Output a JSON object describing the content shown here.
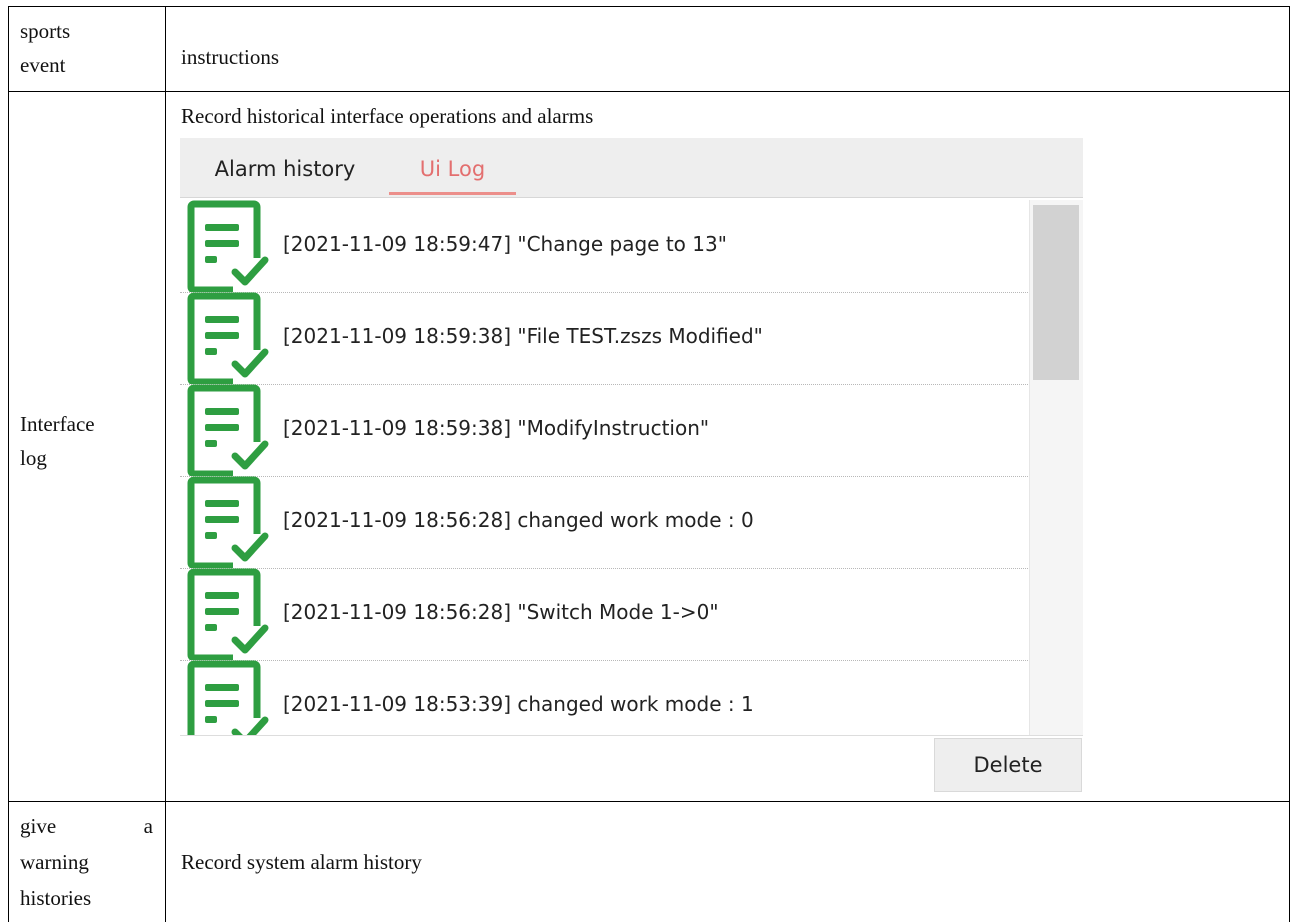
{
  "table": {
    "header": {
      "col1": "sports\nevent",
      "col2": "instructions"
    },
    "row_interface_log": {
      "label": "Interface\nlog",
      "description": "Record historical interface operations and alarms"
    },
    "row_alarm_history": {
      "label": "give a\nwarning\nhistories",
      "label_lines": [
        "give",
        "a",
        "warning",
        "histories"
      ],
      "description": "Record system alarm history"
    }
  },
  "ui_panel": {
    "tabs": [
      {
        "label": "Alarm history",
        "active": false
      },
      {
        "label": "Ui Log",
        "active": true
      }
    ],
    "log_entries": [
      {
        "icon": "log-check-icon",
        "text": "[2021-11-09 18:59:47] \"Change page to 13\""
      },
      {
        "icon": "log-check-icon",
        "text": "[2021-11-09 18:59:38] \"File  TEST.zszs Modified\""
      },
      {
        "icon": "log-check-icon",
        "text": "[2021-11-09 18:59:38] \"ModifyInstruction\""
      },
      {
        "icon": "log-check-icon",
        "text": "[2021-11-09 18:56:28] changed work mode :  0"
      },
      {
        "icon": "log-check-icon",
        "text": "[2021-11-09 18:56:28] \"Switch Mode 1->0\""
      },
      {
        "icon": "log-check-icon",
        "text": "[2021-11-09 18:53:39] changed work mode :  1"
      }
    ],
    "delete_label": "Delete",
    "colors": {
      "accent_tab": "#e36f6f",
      "icon_green": "#2e9e41"
    }
  }
}
